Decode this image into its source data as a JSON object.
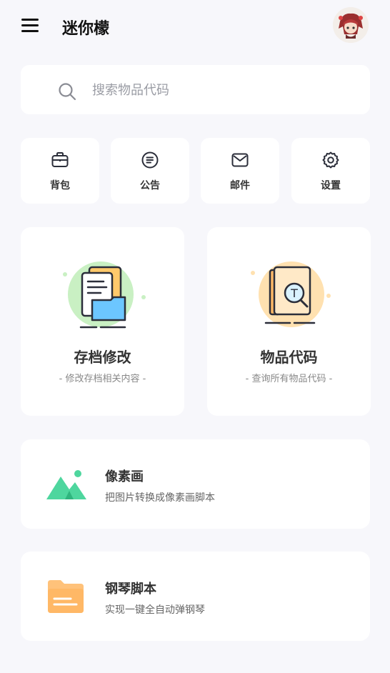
{
  "header": {
    "title": "迷你檬",
    "menu_icon": "hamburger-menu-icon",
    "avatar_icon": "avatar"
  },
  "search": {
    "placeholder": "搜索物品代码",
    "icon": "search-icon"
  },
  "quick_actions": [
    {
      "label": "背包",
      "icon": "briefcase-icon"
    },
    {
      "label": "公告",
      "icon": "notice-icon"
    },
    {
      "label": "邮件",
      "icon": "mail-icon"
    },
    {
      "label": "设置",
      "icon": "settings-icon"
    }
  ],
  "feature_cards": [
    {
      "title": "存档修改",
      "subtitle": "- 修改存档相关内容 -",
      "icon": "folder-document-icon",
      "accent": "#c9f0c3"
    },
    {
      "title": "物品代码",
      "subtitle": "- 查询所有物品代码 -",
      "icon": "book-search-icon",
      "accent": "#ffe1b0"
    }
  ],
  "list_cards": [
    {
      "title": "像素画",
      "subtitle": "把图片转换成像素画脚本",
      "icon": "mountain-image-icon",
      "accent": "#4ed69e"
    },
    {
      "title": "钢琴脚本",
      "subtitle": "实现一键全自动弹钢琴",
      "icon": "folder-icon",
      "accent": "#ffb866"
    }
  ]
}
